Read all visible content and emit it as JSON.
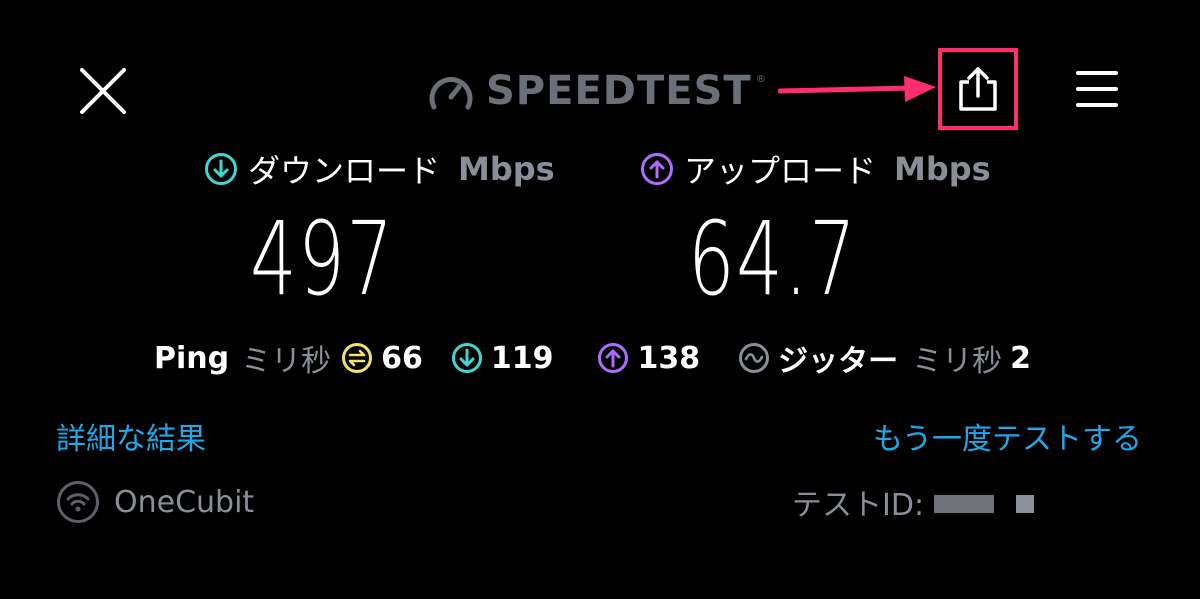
{
  "header": {
    "logo_text": "SPEEDTEST",
    "logo_tm": "®"
  },
  "download": {
    "label": "ダウンロード",
    "unit": "Mbps",
    "value": "497"
  },
  "upload": {
    "label": "アップロード",
    "unit": "Mbps",
    "value": "64.7"
  },
  "ping": {
    "label": "Ping",
    "unit": "ミリ秒",
    "idle": "66",
    "download": "119",
    "upload": "138"
  },
  "jitter": {
    "label": "ジッター",
    "unit": "ミリ秒",
    "value": "2"
  },
  "links": {
    "details": "詳細な結果",
    "retest": "もう一度テストする"
  },
  "footer": {
    "network": "OneCubit",
    "test_id_label": "テストID:"
  },
  "colors": {
    "download_accent": "#3fd7d0",
    "upload_accent": "#b06bff",
    "ping_accent": "#f5e26b",
    "link": "#1fa8e8",
    "highlight": "#ff2e6e"
  }
}
